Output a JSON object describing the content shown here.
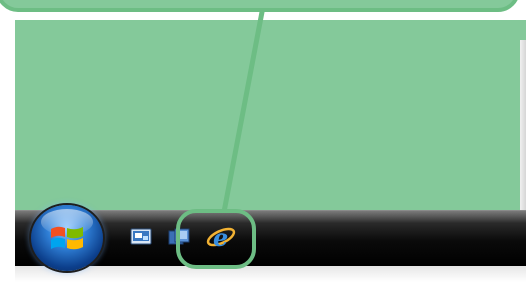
{
  "colors": {
    "callout_green": "#84c99a",
    "callout_border": "#6dbd84",
    "taskbar_black": "#000000",
    "orb_blue": "#2f7fd6"
  },
  "taskbar": {
    "start_button": {
      "icon": "windows-start-orb-icon"
    },
    "quick_launch": [
      {
        "name": "show-desktop",
        "icon": "show-desktop-icon"
      },
      {
        "name": "switch-between-windows",
        "icon": "switch-windows-icon"
      },
      {
        "name": "internet-explorer",
        "icon": "internet-explorer-icon",
        "highlighted": true
      }
    ]
  }
}
